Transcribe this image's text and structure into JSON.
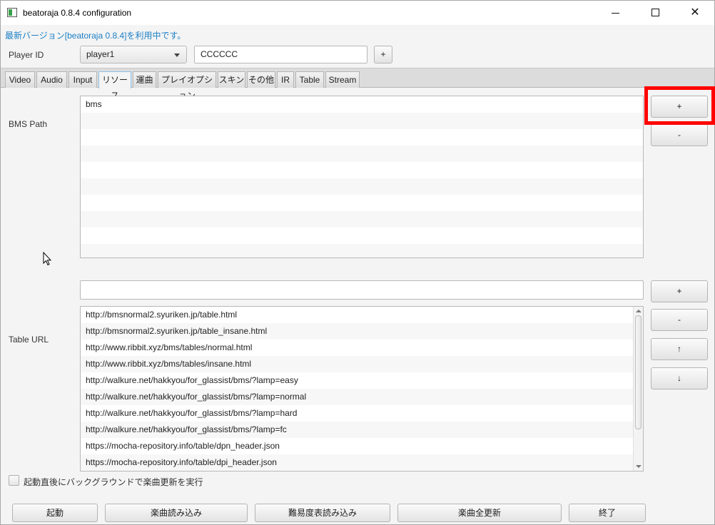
{
  "window": {
    "title": "beatoraja 0.8.4 configuration"
  },
  "notice": "最新バージョン[beatoraja 0.8.4]を利用中です。",
  "player": {
    "label": "Player ID",
    "selected": "player1",
    "name_value": "CCCCCC",
    "add_label": "+"
  },
  "tabs": [
    {
      "label": "Video"
    },
    {
      "label": "Audio"
    },
    {
      "label": "Input"
    },
    {
      "label": "リソース"
    },
    {
      "label": "運曲"
    },
    {
      "label": "プレイオプション"
    },
    {
      "label": "スキン"
    },
    {
      "label": "その他"
    },
    {
      "label": "IR"
    },
    {
      "label": "Table"
    },
    {
      "label": "Stream"
    }
  ],
  "active_tab": "リソース",
  "bms_path": {
    "label": "BMS Path",
    "items": [
      "bms"
    ],
    "add_label": "+",
    "remove_label": "-"
  },
  "table_url": {
    "label": "Table URL",
    "input_value": "",
    "items": [
      "http://bmsnormal2.syuriken.jp/table.html",
      "http://bmsnormal2.syuriken.jp/table_insane.html",
      "http://www.ribbit.xyz/bms/tables/normal.html",
      "http://www.ribbit.xyz/bms/tables/insane.html",
      "http://walkure.net/hakkyou/for_glassist/bms/?lamp=easy",
      "http://walkure.net/hakkyou/for_glassist/bms/?lamp=normal",
      "http://walkure.net/hakkyou/for_glassist/bms/?lamp=hard",
      "http://walkure.net/hakkyou/for_glassist/bms/?lamp=fc",
      "https://mocha-repository.info/table/dpn_header.json",
      "https://mocha-repository.info/table/dpi_header.json"
    ],
    "add_label": "+",
    "remove_label": "-",
    "up_label": "↑",
    "down_label": "↓"
  },
  "background_update": {
    "label": "起動直後にバックグラウンドで楽曲更新を実行",
    "checked": false
  },
  "footer": {
    "start": "起動",
    "load_songs": "楽曲読み込み",
    "load_tables": "難易度表読み込み",
    "update_all": "楽曲全更新",
    "exit": "終了"
  }
}
